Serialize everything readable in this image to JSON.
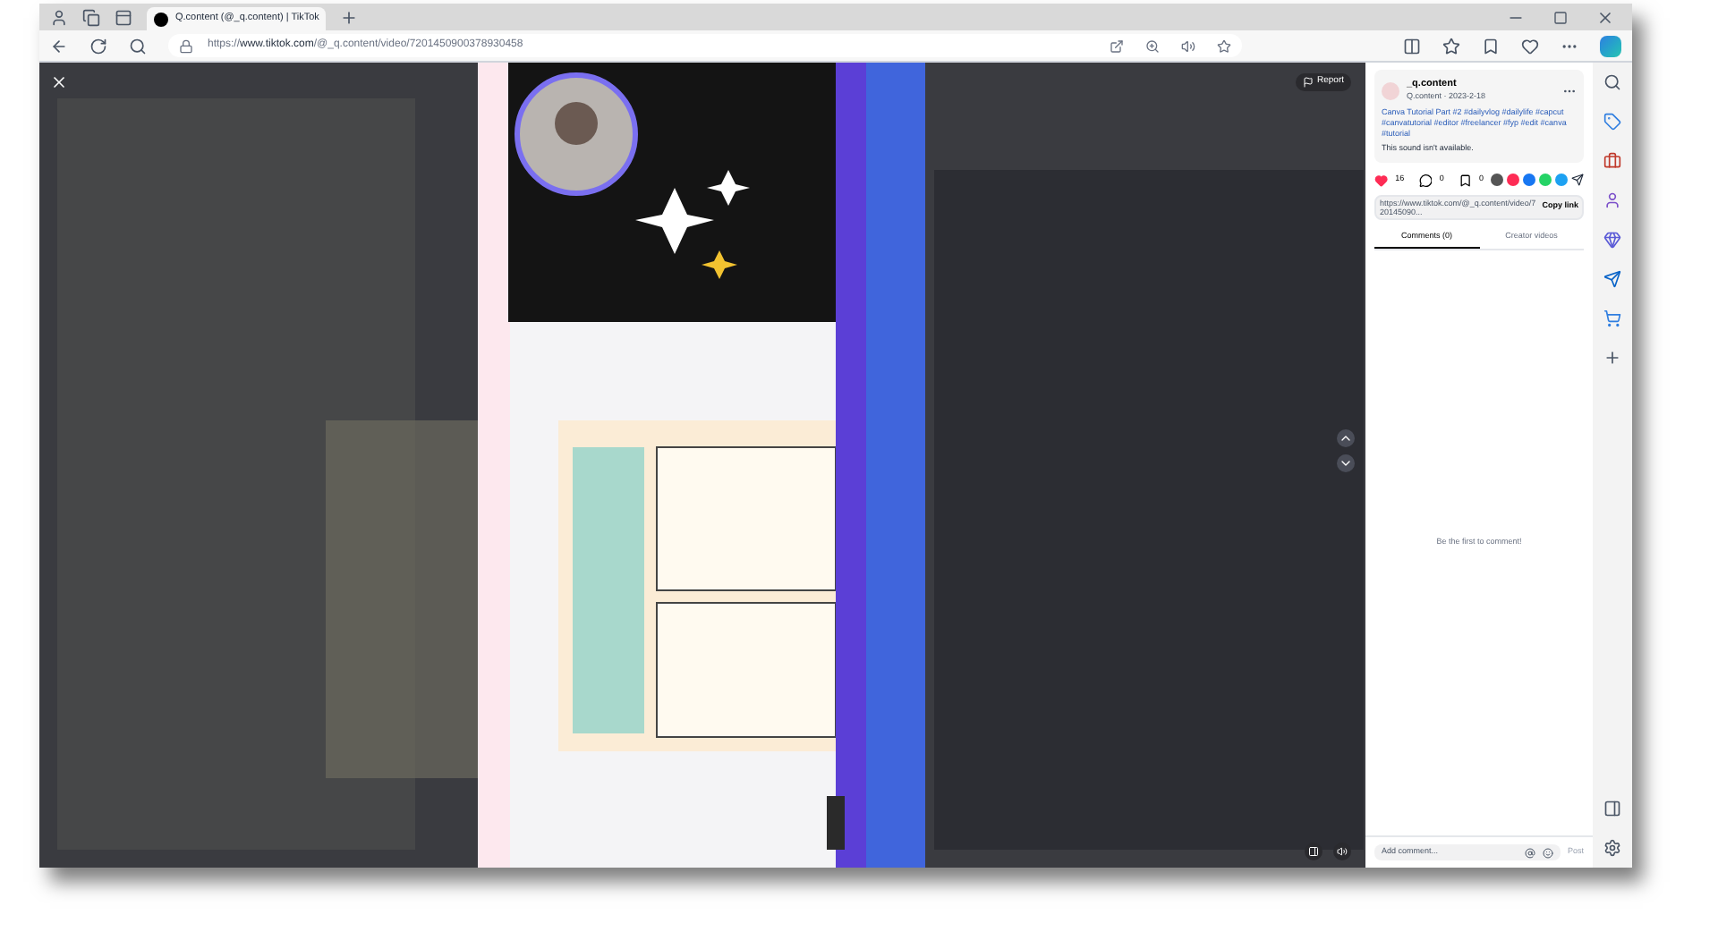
{
  "browser": {
    "tab": {
      "title": "Q.content (@_q.content) | TikTok",
      "selected": true
    },
    "url_prefix": "https://",
    "url_host": "www.tiktok.com",
    "url_path": "/@_q.content/video/7201450900378930458"
  },
  "video": {
    "kind": "picture",
    "report": "Report"
  },
  "post": {
    "username": "_q.content",
    "meta": "Q.content · 2023-2-18",
    "caption": "Canva Tutorial Part #2 #dailyvlog #dailylife #capcut #canvatutorial #editor #freelancer #fyp #edit #canva #tutorial",
    "sound": "This sound isn't available.",
    "likes": "16",
    "comments": "0",
    "saves": "0",
    "link": "https://www.tiktok.com/@_q.content/video/720145090...",
    "copy": "Copy link"
  },
  "tabs": [
    {
      "label": "Comments (0)",
      "selected": true
    },
    {
      "label": "Creator videos",
      "selected": false
    }
  ],
  "empty": "Be the first to comment!",
  "comment_box": {
    "placeholder": "Add comment...",
    "post": "Post"
  }
}
